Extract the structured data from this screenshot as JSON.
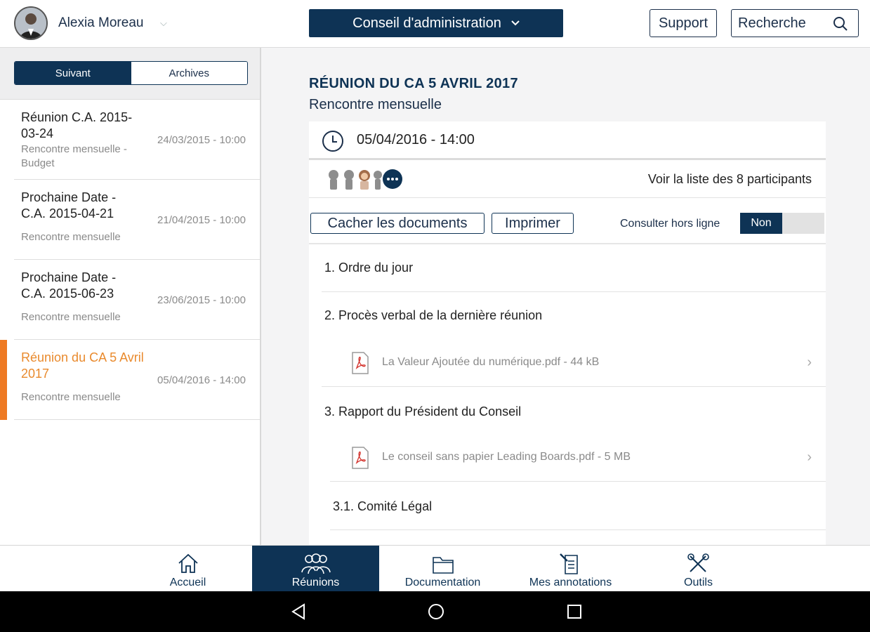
{
  "header": {
    "user_name": "Alexia Moreau",
    "council_label": "Conseil d'administration",
    "support_label": "Support",
    "search_label": "Recherche"
  },
  "sidebar": {
    "segments": [
      {
        "label": "Suivant",
        "active": true
      },
      {
        "label": "Archives",
        "active": false
      }
    ],
    "meetings": [
      {
        "title": "Réunion C.A. 2015-03-24",
        "subtitle": "Rencontre mensuelle - Budget",
        "date": "24/03/2015 - 10:00",
        "active": false
      },
      {
        "title": "Prochaine Date - C.A. 2015-04-21",
        "subtitle": "Rencontre mensuelle",
        "date": "21/04/2015 - 10:00",
        "active": false
      },
      {
        "title": "Prochaine Date - C.A. 2015-06-23",
        "subtitle": "Rencontre mensuelle",
        "date": "23/06/2015 - 10:00",
        "active": false
      },
      {
        "title": "Réunion du CA 5 Avril 2017",
        "subtitle": "Rencontre mensuelle",
        "date": "05/04/2016 - 14:00",
        "active": true
      }
    ]
  },
  "meeting": {
    "title": "RÉUNION DU CA 5 AVRIL 2017",
    "subtitle": "Rencontre mensuelle",
    "datetime": "05/04/2016 - 14:00",
    "participants_link": "Voir la liste des 8 participants",
    "hide_docs_label": "Cacher les documents",
    "print_label": "Imprimer",
    "offline_label": "Consulter hors ligne",
    "offline_value": "Non",
    "agenda": [
      {
        "label": "1. Ordre du jour"
      },
      {
        "label": "2. Procès verbal de la dernière réunion"
      },
      {
        "label": "La Valeur Ajoutée du numérique.pdf -  44 kB"
      },
      {
        "label": "3. Rapport du Président du Conseil"
      },
      {
        "label": "Le conseil sans papier Leading Boards.pdf -  5 MB"
      },
      {
        "label": "3.1. Comité Légal"
      }
    ]
  },
  "nav": {
    "items": [
      {
        "label": "Accueil",
        "icon": "home-icon"
      },
      {
        "label": "Réunions",
        "icon": "people-icon"
      },
      {
        "label": "Documentation",
        "icon": "folder-icon"
      },
      {
        "label": "Mes annotations",
        "icon": "annotation-icon"
      },
      {
        "label": "Outils",
        "icon": "tools-icon"
      }
    ]
  },
  "colors": {
    "primary": "#0e3355",
    "accent": "#ee7a23",
    "active_text": "#e98a2d"
  }
}
